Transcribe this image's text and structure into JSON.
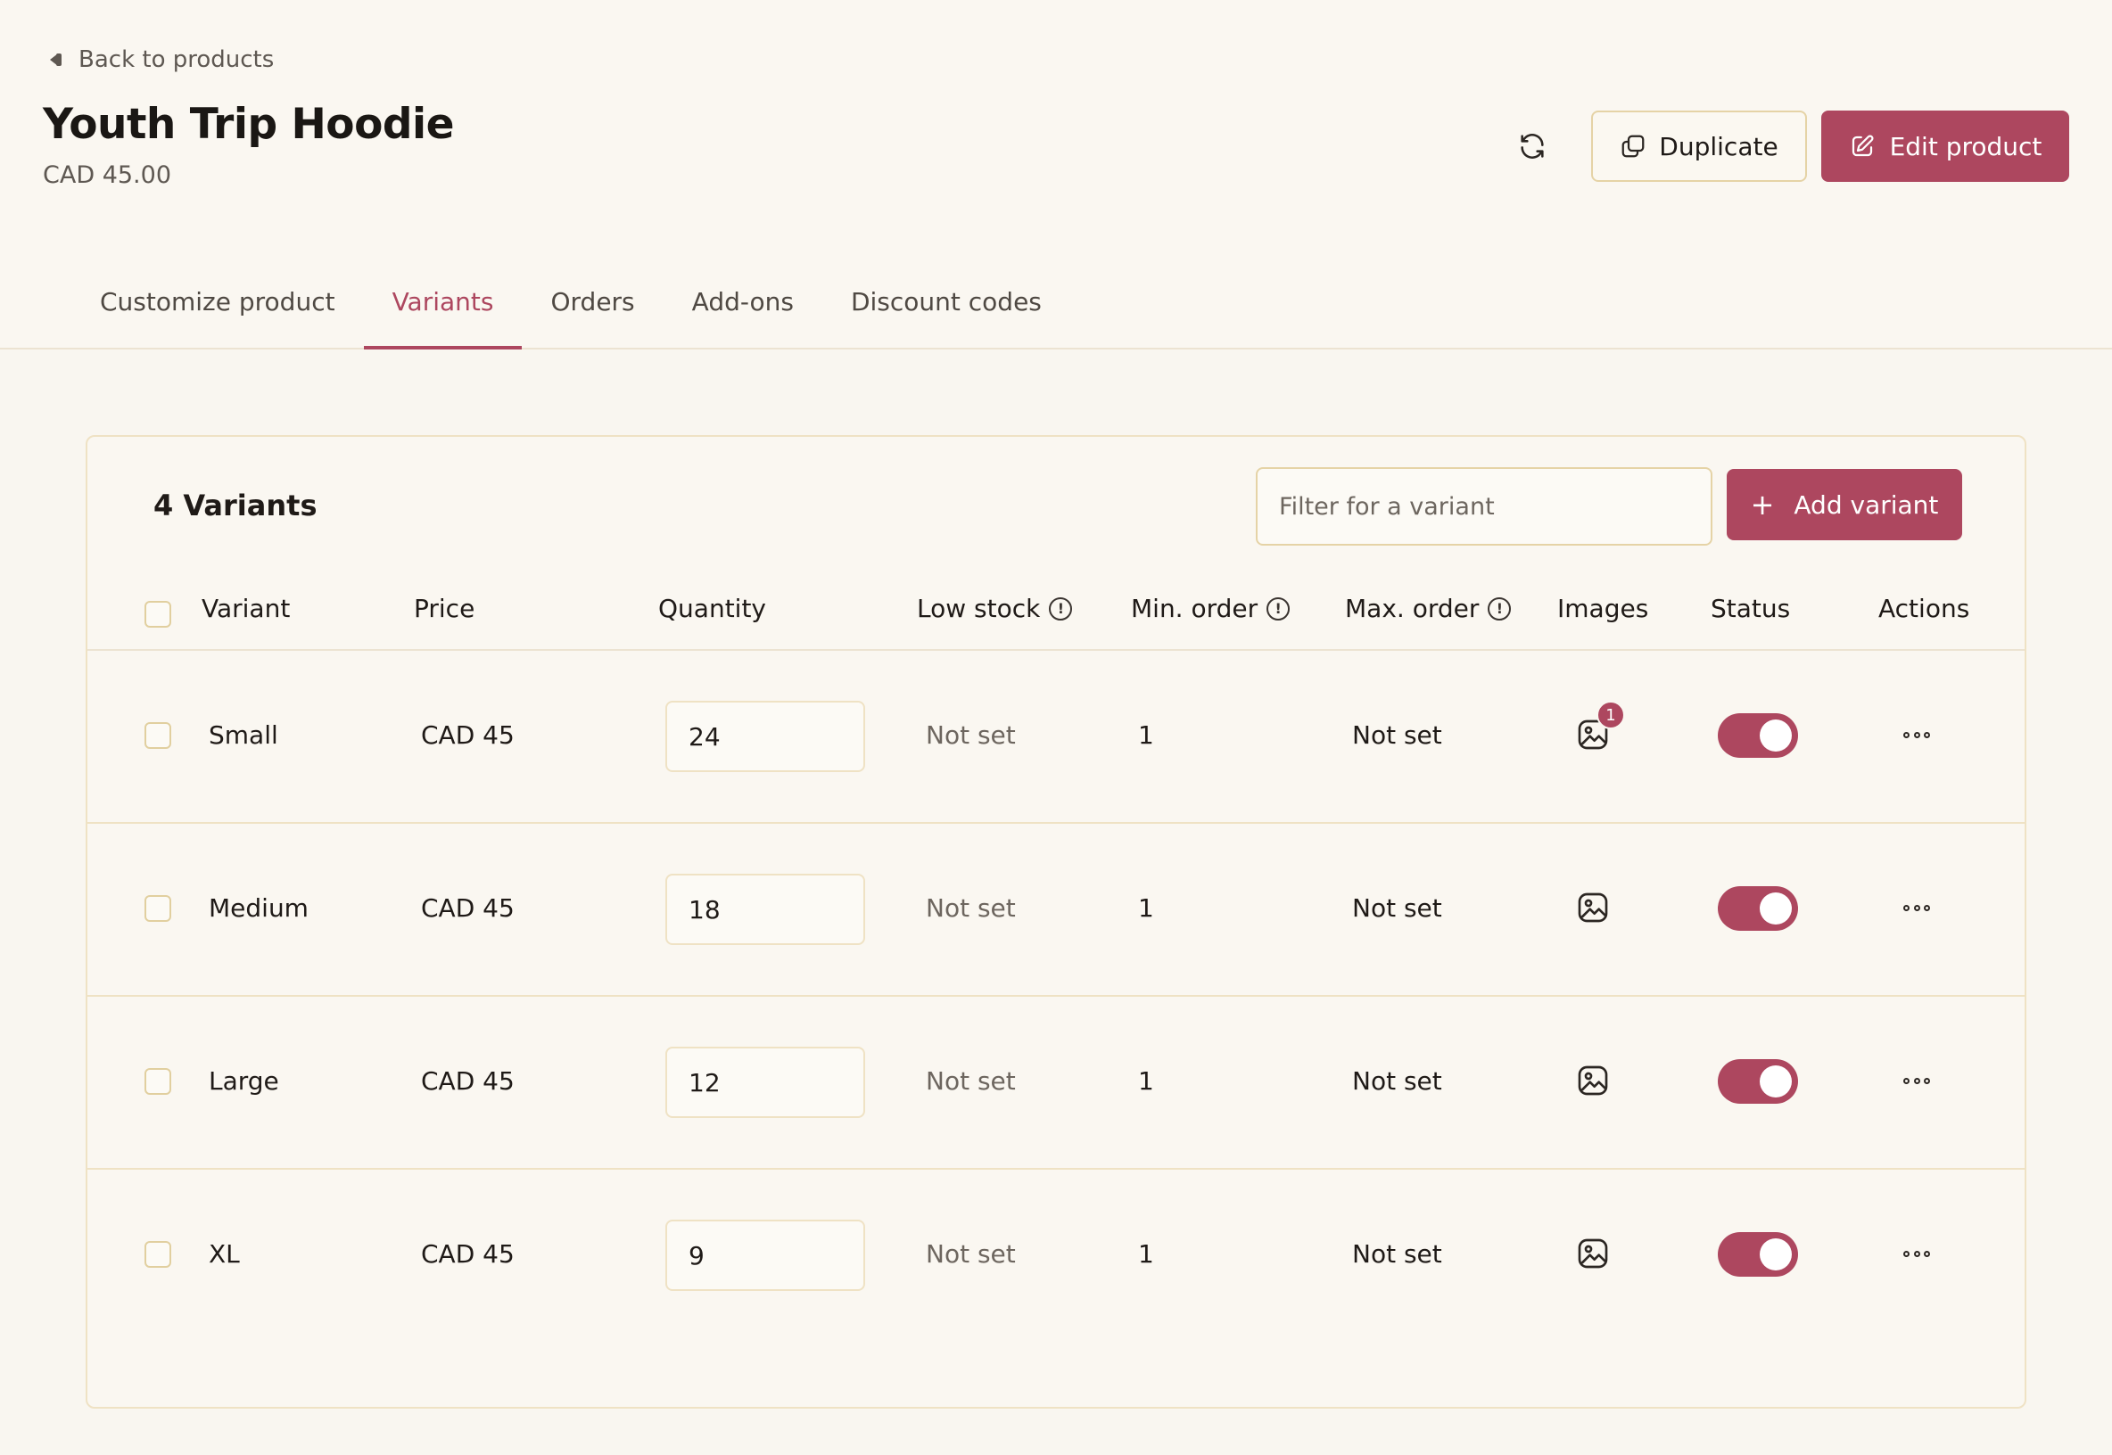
{
  "nav": {
    "back_label": "Back to products"
  },
  "product": {
    "title": "Youth Trip Hoodie",
    "price": "CAD 45.00"
  },
  "header_actions": {
    "duplicate_label": "Duplicate",
    "edit_label": "Edit product"
  },
  "tabs": [
    {
      "label": "Customize product",
      "active": false
    },
    {
      "label": "Variants",
      "active": true
    },
    {
      "label": "Orders",
      "active": false
    },
    {
      "label": "Add-ons",
      "active": false
    },
    {
      "label": "Discount codes",
      "active": false
    }
  ],
  "variants_panel": {
    "count_label": "4 Variants",
    "filter_placeholder": "Filter for a variant",
    "add_label": "Add variant",
    "columns": {
      "variant": "Variant",
      "price": "Price",
      "quantity": "Quantity",
      "low_stock": "Low stock",
      "min_order": "Min. order",
      "max_order": "Max. order",
      "images": "Images",
      "status": "Status",
      "actions": "Actions"
    },
    "rows": [
      {
        "name": "Small",
        "price": "CAD 45",
        "quantity": "24",
        "low_stock": "Not set",
        "min_order": "1",
        "max_order": "Not set",
        "image_count": "1",
        "status_on": true
      },
      {
        "name": "Medium",
        "price": "CAD 45",
        "quantity": "18",
        "low_stock": "Not set",
        "min_order": "1",
        "max_order": "Not set",
        "image_count": "",
        "status_on": true
      },
      {
        "name": "Large",
        "price": "CAD 45",
        "quantity": "12",
        "low_stock": "Not set",
        "min_order": "1",
        "max_order": "Not set",
        "image_count": "",
        "status_on": true
      },
      {
        "name": "XL",
        "price": "CAD 45",
        "quantity": "9",
        "low_stock": "Not set",
        "min_order": "1",
        "max_order": "Not set",
        "image_count": "",
        "status_on": true
      }
    ]
  },
  "colors": {
    "accent": "#ad475f",
    "background": "#f9f6f0",
    "border": "#e5d3a6"
  }
}
